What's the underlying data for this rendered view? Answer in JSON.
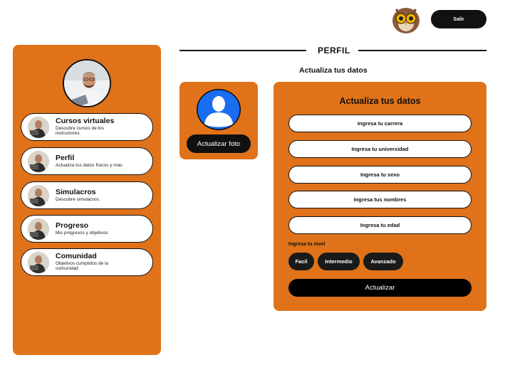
{
  "header": {
    "logo_icon": "owl-logo-icon",
    "logout_label": "Salir"
  },
  "sidebar": {
    "avatar_icon": "user-photo-avatar",
    "items": [
      {
        "title": "Cursos virtuales",
        "desc": "Descubre cursos de los instructores",
        "icon": "course-thumbnail"
      },
      {
        "title": "Perfil",
        "desc": "Actualiza tus datos fisicos y más",
        "icon": "profile-thumbnail"
      },
      {
        "title": "Simulacros",
        "desc": "Descubre simulacros.",
        "icon": "simulation-thumbnail"
      },
      {
        "title": "Progreso",
        "desc": "Mis progresos y objetivos",
        "icon": "progress-thumbnail"
      },
      {
        "title": "Comunidad",
        "desc": "Objetivos cumplidos de la comunidad",
        "icon": "community-thumbnail"
      }
    ]
  },
  "main": {
    "title": "PERFIL",
    "subtitle": "Actualiza tus datos",
    "photo_button": "Actualizar foto",
    "form": {
      "title": "Actualiza tus datos",
      "fields": [
        {
          "placeholder": "Ingresa tu carrera"
        },
        {
          "placeholder": "Ingresa tu universidad"
        },
        {
          "placeholder": "Ingresa tu sexo"
        },
        {
          "placeholder": "Ingresa tus nombres"
        },
        {
          "placeholder": "Ingresa tu edad"
        }
      ],
      "level_label": "Ingresa tu nivel",
      "levels": [
        "Facil",
        "Intermedio",
        "Avanzado"
      ],
      "submit_label": "Actualizar"
    }
  },
  "colors": {
    "accent": "#e0721a",
    "dark": "#111111",
    "avatar_blue": "#1a6cf0"
  }
}
